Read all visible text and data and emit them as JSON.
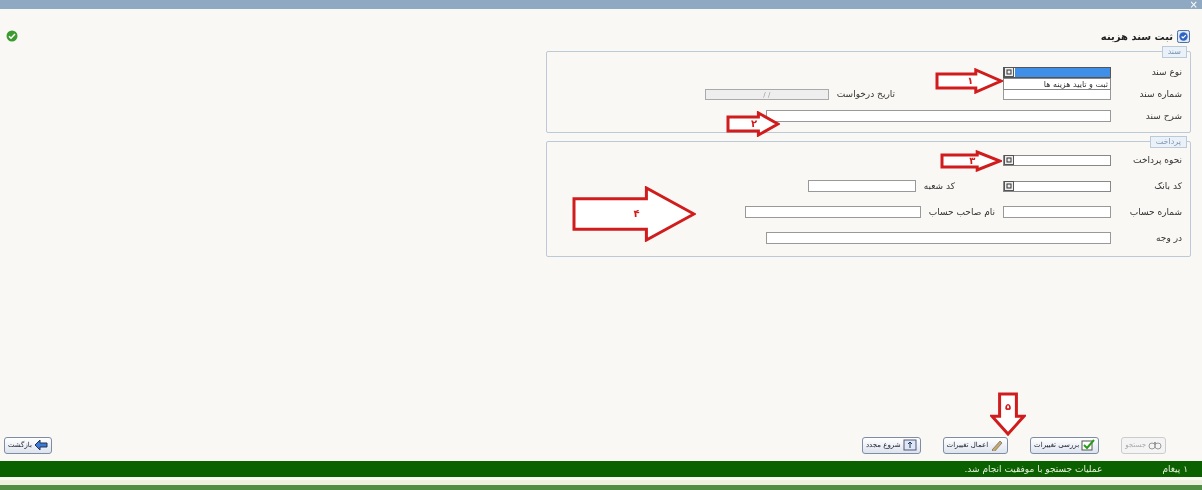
{
  "window": {
    "close": "×"
  },
  "header": {
    "title": "ثبت سند هزینه"
  },
  "sections": [
    {
      "legend": "سند",
      "rows": [
        [
          {
            "label": "نوع سند",
            "kind": "select",
            "open": true,
            "options": [
              "ثبت و تایید هزینه ها"
            ]
          }
        ],
        [
          {
            "label": "شماره سند",
            "kind": "text"
          },
          {
            "label": "تاریخ درخواست",
            "kind": "date",
            "value": "/ /"
          }
        ],
        [
          {
            "label": "شرح سند",
            "kind": "long"
          }
        ]
      ]
    },
    {
      "legend": "پرداخت",
      "rows": [
        [
          {
            "label": "نحوه پرداخت",
            "kind": "select",
            "open": false
          }
        ],
        [
          {
            "label": "کد بانک",
            "kind": "select",
            "open": false
          },
          {
            "label": "کد شعبه",
            "kind": "text"
          }
        ],
        [
          {
            "label": "شماره حساب",
            "kind": "text"
          },
          {
            "label": "نام صاحب حساب",
            "kind": "mid"
          }
        ],
        [
          {
            "label": "در وجه",
            "kind": "long"
          }
        ]
      ]
    }
  ],
  "callouts": [
    {
      "number": "۱",
      "kind": "rightward"
    },
    {
      "number": "۲",
      "kind": "rightward"
    },
    {
      "number": "۳",
      "kind": "rightward"
    },
    {
      "number": "۴",
      "kind": "rightward"
    },
    {
      "number": "۵",
      "kind": "downward"
    }
  ],
  "buttons": [
    {
      "label": "جستجو",
      "kind": "search",
      "disabled": true
    },
    {
      "label": "بررسی تغییرات",
      "kind": "review",
      "disabled": false
    },
    {
      "label": "اعمال تغییرات",
      "kind": "apply",
      "disabled": false
    },
    {
      "label": "شروع مجدد",
      "kind": "restart",
      "disabled": false
    }
  ],
  "back_button": {
    "label": "بازگشت"
  },
  "status_bar": {
    "count": "۱ پیغام",
    "message": "عملیات جستجو با موفقیت انجام شد."
  }
}
